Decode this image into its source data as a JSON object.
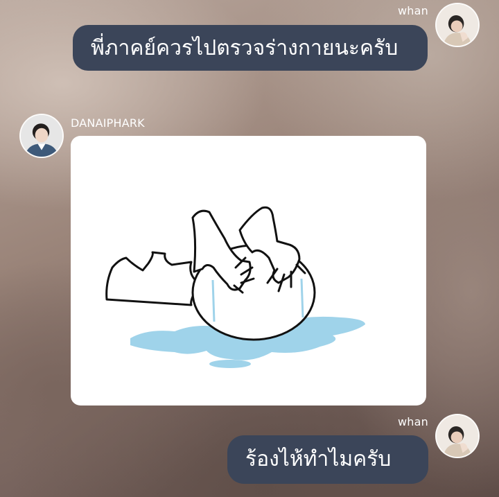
{
  "messages": [
    {
      "sender": "whan",
      "side": "right",
      "type": "text",
      "text": "พี่ภาคย์ควรไปตรวจร่างกายนะครับ"
    },
    {
      "sender": "DANAIPHARK",
      "side": "left",
      "type": "sticker",
      "sticker_icon": "crying-character-sticker"
    },
    {
      "sender": "whan",
      "side": "right",
      "type": "text",
      "text": "ร้องไห้ทำไมครับ"
    }
  ],
  "colors": {
    "bubble": "#3b4559",
    "bubble_text": "#ffffff",
    "name_text": "#ffffff",
    "sticker_tears": "#9fd3ea"
  }
}
